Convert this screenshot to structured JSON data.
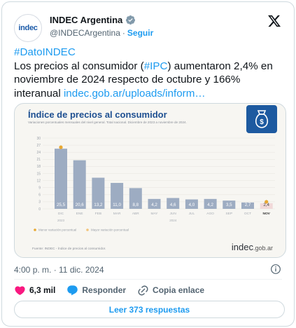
{
  "header": {
    "avatar_text": "indec",
    "name": "INDEC Argentina",
    "handle": "@INDECArgentina",
    "separator": "·",
    "follow_label": "Seguir"
  },
  "tweet": {
    "hashtag": "#DatoINDEC",
    "text_1": "Los precios al consumidor (",
    "hashtag_ipc": "#IPC",
    "text_2": ") aumentaron 2,4% en noviembre de 2024 respecto de octubre y 166% interanual ",
    "link": "indec.gob.ar/uploads/inform…"
  },
  "media": {
    "title": "Índice de precios al consumidor",
    "subtitle": "Variaciones porcentuales mensuales del nivel general. Total nacional. Diciembre de 2023 a noviembre de 2024.",
    "legend_low": "Menor variación porcentual",
    "legend_high": "Mayor variación porcentual",
    "year_2023": "2023",
    "year_2024": "2024",
    "source": "Fuente: INDEC - Índice de precios al consumidor.",
    "brand_main": "indec",
    "brand_suffix": ".gob.ar",
    "colors": {
      "bar": "#9dacc2",
      "bar_last": "#f1d9d9",
      "dot": "#e8a832",
      "title": "#1d4f91"
    }
  },
  "chart_data": {
    "type": "bar",
    "title": "Índice de precios al consumidor",
    "categories": [
      "DIC",
      "ENE",
      "FEB",
      "MAR",
      "ABR",
      "MAY",
      "JUN",
      "JUL",
      "AGO",
      "SEP",
      "OCT",
      "NOV"
    ],
    "values": [
      25.5,
      20.6,
      13.2,
      11.0,
      8.8,
      4.2,
      4.6,
      4.0,
      4.2,
      3.5,
      2.7,
      2.4
    ],
    "value_labels": [
      "25,5",
      "20,6",
      "13,2",
      "11,0",
      "8,8",
      "4,2",
      "4,6",
      "4,0",
      "4,2",
      "3,5",
      "2,7",
      "2,4"
    ],
    "y_ticks": [
      "0",
      "3",
      "6",
      "9",
      "12",
      "15",
      "18",
      "21",
      "24",
      "27",
      "30"
    ],
    "ylim": [
      0,
      30
    ],
    "highlight_max": "DIC",
    "highlight_min": "NOV"
  },
  "meta": {
    "time": "4:00 p. m. · 11 dic. 2024"
  },
  "actions": {
    "likes": "6,3 mil",
    "reply_label": "Responder",
    "copy_label": "Copia enlace"
  },
  "replies_button": "Leer 373 respuestas"
}
